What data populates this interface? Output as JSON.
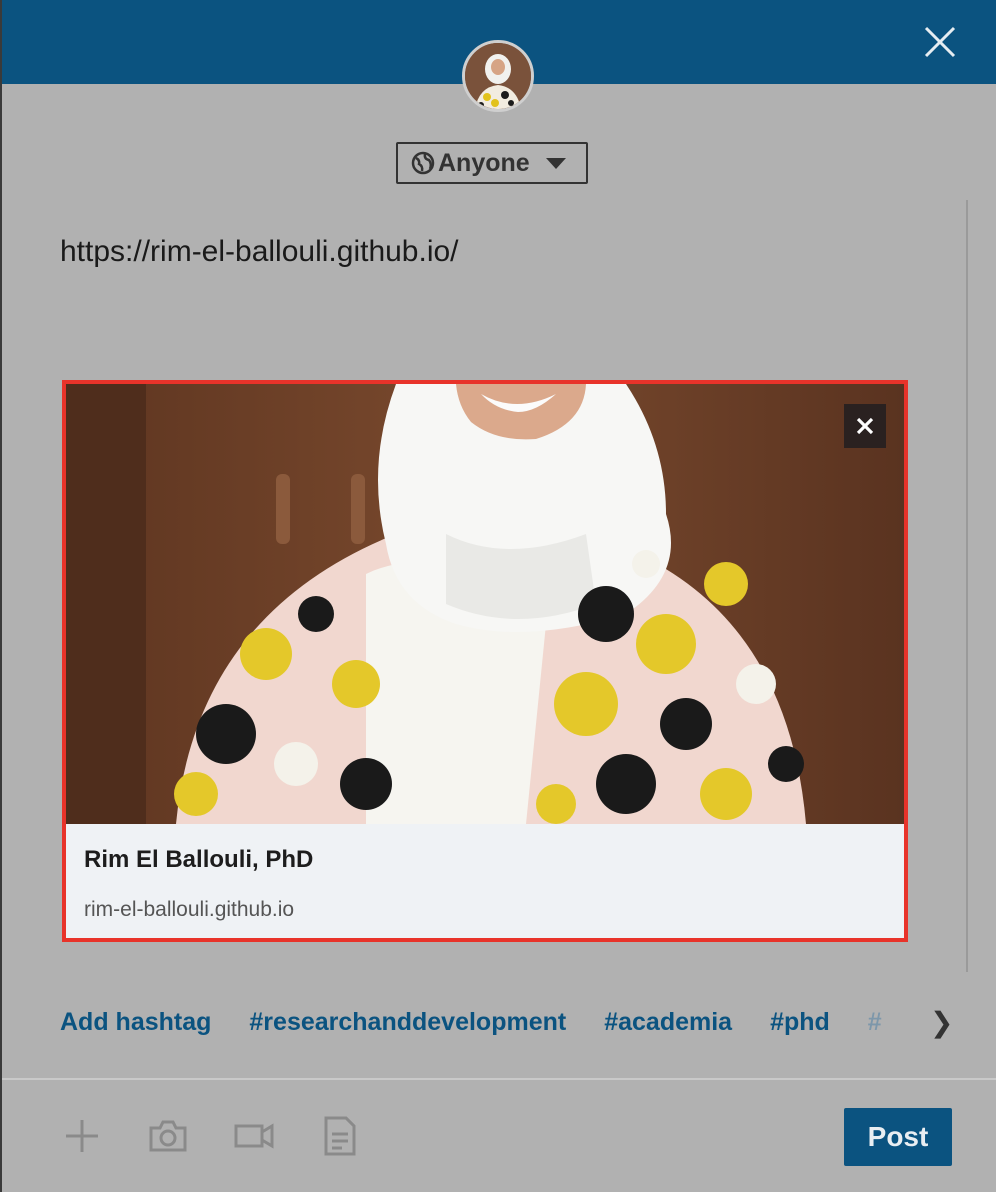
{
  "composer": {
    "visibility_label": "Anyone",
    "post_text": "https://rim-el-ballouli.github.io/"
  },
  "link_preview": {
    "title": "Rim El Ballouli, PhD",
    "domain": "rim-el-ballouli.github.io"
  },
  "hashtags": {
    "add_label": "Add hashtag",
    "tags": [
      "#researchanddevelopment",
      "#academia",
      "#phd",
      "#"
    ]
  },
  "footer": {
    "post_label": "Post"
  },
  "icons": {
    "close": "close-icon",
    "globe": "globe-icon",
    "add": "plus-icon",
    "camera": "camera-icon",
    "video": "video-icon",
    "document": "document-icon"
  },
  "colors": {
    "brand_blue": "#0b5380",
    "overlay": "#b1b1b1",
    "preview_border": "#e8332a"
  }
}
